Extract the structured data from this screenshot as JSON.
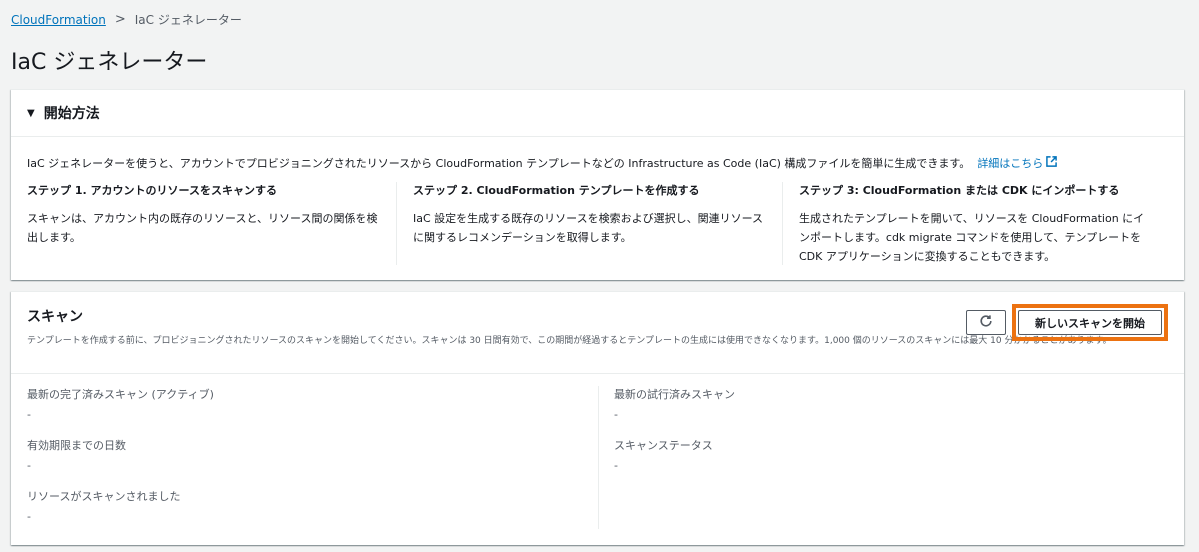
{
  "breadcrumb": {
    "root": "CloudFormation",
    "separator": ">",
    "current": "IaC ジェネレーター"
  },
  "page_title": "IaC ジェネレーター",
  "getting_started": {
    "title": "開始方法",
    "intro": "IaC ジェネレーターを使うと、アカウントでプロビジョニングされたリソースから CloudFormation テンプレートなどの Infrastructure as Code (IaC) 構成ファイルを簡単に生成できます。",
    "learn_more": "詳細はこちら",
    "steps": [
      {
        "title": "ステップ 1. アカウントのリソースをスキャンする",
        "description": "スキャンは、アカウント内の既存のリソースと、リソース間の関係を検出します。"
      },
      {
        "title": "ステップ 2. CloudFormation テンプレートを作成する",
        "description": "IaC 設定を生成する既存のリソースを検索および選択し、関連リソースに関するレコメンデーションを取得します。"
      },
      {
        "title": "ステップ 3: CloudFormation または CDK にインポートする",
        "description": "生成されたテンプレートを開いて、リソースを CloudFormation にインポートします。cdk migrate コマンドを使用して、テンプレートを CDK アプリケーションに変換することもできます。"
      }
    ]
  },
  "scan": {
    "title": "スキャン",
    "description": "テンプレートを作成する前に、プロビジョニングされたリソースのスキャンを開始してください。スキャンは 30 日間有効で、この期間が経過するとテンプレートの生成には使用できなくなります。1,000 個のリソースのスキャンには最大 10 分かかることがあります。",
    "start_button": "新しいスキャンを開始",
    "left": [
      {
        "label": "最新の完了済みスキャン (アクティブ)",
        "value": "-"
      },
      {
        "label": "有効期限までの日数",
        "value": "-"
      },
      {
        "label": "リソースがスキャンされました",
        "value": "-"
      }
    ],
    "right": [
      {
        "label": "最新の試行済みスキャン",
        "value": "-"
      },
      {
        "label": "スキャンステータス",
        "value": "-"
      }
    ]
  },
  "colors": {
    "link": "#0073bb",
    "highlight": "#ec7211",
    "background": "#f2f3f3"
  }
}
